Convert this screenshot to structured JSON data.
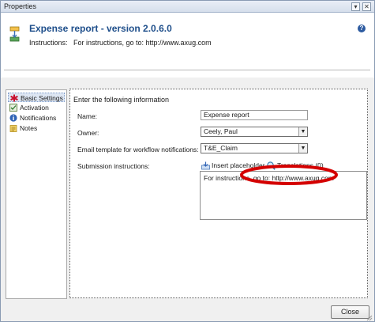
{
  "window": {
    "title": "Properties",
    "minimize_glyph": "▾",
    "close_glyph": "✕"
  },
  "header": {
    "title": "Expense report - version 2.0.6.0",
    "instructions_label": "Instructions:",
    "instructions_value": "For instructions, go to:  http://www.axug.com",
    "help_glyph": "?"
  },
  "nav": {
    "items": [
      {
        "label": "Basic Settings",
        "icon": "red-star-icon"
      },
      {
        "label": "Activation",
        "icon": "activation-icon"
      },
      {
        "label": "Notifications",
        "icon": "info-icon"
      },
      {
        "label": "Notes",
        "icon": "notes-icon"
      }
    ]
  },
  "form": {
    "heading": "Enter the following information",
    "name_label": "Name:",
    "name_value": "Expense report",
    "owner_label": "Owner:",
    "owner_value": "Ceely, Paul",
    "email_label": "Email template for workflow notifications:",
    "email_value": "T&E_Claim",
    "submission_label": "Submission instructions:",
    "insert_placeholder": "Insert placeholder",
    "translations": "Translations (0)",
    "submission_value": "For instructions, go to:  http://www.axug.com"
  },
  "footer": {
    "close_label": "Close"
  },
  "colors": {
    "title_blue": "#1f4f8b",
    "annotation_red": "#d40000",
    "selection": "#dde6f3"
  }
}
